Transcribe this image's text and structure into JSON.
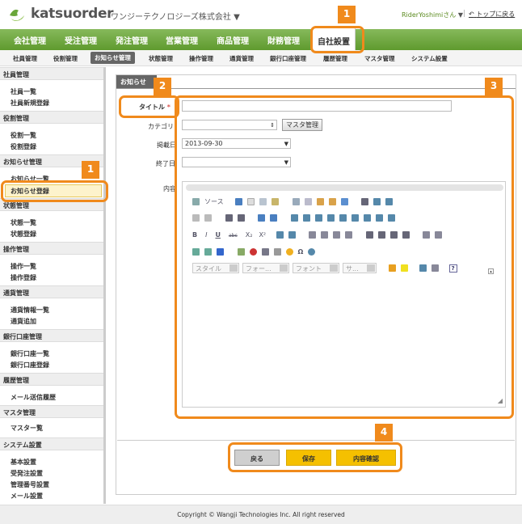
{
  "header": {
    "logo_text": "katsuorder",
    "company": "ワンジーテクノロジーズ株式会社 ▼",
    "user": "RiderYoshimiさん",
    "user_caret": "▼",
    "separator": "|",
    "back_link": "トップに戻る",
    "back_icon": "return-arrow-icon"
  },
  "main_nav": [
    "会社管理",
    "受注管理",
    "発注管理",
    "営業管理",
    "商品管理",
    "財務管理",
    "自社設置"
  ],
  "sub_nav": [
    "社員管理",
    "役割管理",
    "お知らせ管理",
    "状態管理",
    "操作管理",
    "通貨管理",
    "銀行口座管理",
    "履歴管理",
    "マスタ管理",
    "システム設置"
  ],
  "sidebar": {
    "sections": [
      {
        "title": "社員管理",
        "items": [
          "社員一覧",
          "社員新規登録"
        ]
      },
      {
        "title": "役割管理",
        "items": [
          "役割一覧",
          "役割登録"
        ]
      },
      {
        "title": "お知らせ管理",
        "items": [
          "お知らせ一覧",
          "お知らせ登録"
        ]
      },
      {
        "title": "状態管理",
        "items": [
          "状態一覧",
          "状態登録"
        ]
      },
      {
        "title": "操作管理",
        "items": [
          "操作一覧",
          "操作登録"
        ]
      },
      {
        "title": "通貨管理",
        "items": [
          "通貨情報一覧",
          "通貨追加"
        ]
      },
      {
        "title": "銀行口座管理",
        "items": [
          "銀行口座一覧",
          "銀行口座登録"
        ]
      },
      {
        "title": "履歴管理",
        "items": [
          "メール送信履歴"
        ]
      },
      {
        "title": "マスタ管理",
        "items": [
          "マスター覧"
        ]
      },
      {
        "title": "システム設置",
        "items": [
          "基本設置",
          "受発注設置",
          "管理番号設置",
          "メール設置"
        ]
      }
    ]
  },
  "content": {
    "tab_label": "お知らせ",
    "form": {
      "title_label": "タイトル",
      "required_mark": "*",
      "title_value": "",
      "category_label": "カテゴリ",
      "category_value": "",
      "master_button": "マスタ管理",
      "post_date_label": "掲載日",
      "post_date_value": "2013-09-30",
      "end_date_label": "終了日",
      "end_date_value": "",
      "body_label": "内容"
    },
    "editor": {
      "source_label": "ソース",
      "style_combo": "スタイル",
      "format_combo": "フォー...",
      "font_combo": "フォント",
      "size_combo": "サ...",
      "bold": "B",
      "italic": "I",
      "underline": "U",
      "strike": "abc",
      "subscript": "X₂",
      "superscript": "X²",
      "omega": "Ω",
      "help": "?"
    },
    "buttons": {
      "back": "戻る",
      "save": "保存",
      "confirm": "内容確認"
    }
  },
  "colors": {
    "brand_green": "#6aa63a",
    "highlight_orange": "#f08a1c",
    "button_yellow": "#f5c000",
    "button_gray": "#cfcfcf"
  },
  "callouts": [
    "1",
    "1",
    "2",
    "3",
    "4"
  ],
  "footer": "Copyright © Wangji Technologies Inc. All right reserved"
}
